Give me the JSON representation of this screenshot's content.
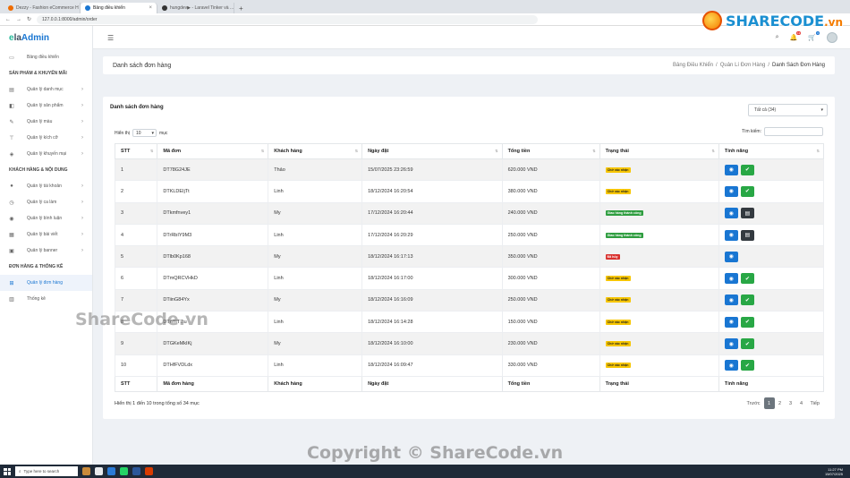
{
  "browser": {
    "tabs": [
      {
        "label": "Dezzy - Fashion eCommerce H",
        "color": "#ef6c00"
      },
      {
        "label": "Bảng điều khiển",
        "color": "#1976d2"
      },
      {
        "label": "hungdev▶ - Laravel Tinker và ...",
        "color": "#333333"
      }
    ],
    "url": "127.0.0.1:8000/admin/order"
  },
  "logo": {
    "e": "e",
    "la": "la",
    "admin": "Admin"
  },
  "sidebar": {
    "dashboard": "Bảng điều khiển",
    "sections": [
      {
        "title": "SẢN PHẨM & KHUYẾN MÃI",
        "items": [
          {
            "label": "Quản lý danh mục",
            "icon": "list-icon"
          },
          {
            "label": "Quản lý sản phẩm",
            "icon": "box-icon"
          },
          {
            "label": "Quản lý màu",
            "icon": "brush-icon"
          },
          {
            "label": "Quản lý kích cỡ",
            "icon": "ruler-icon"
          },
          {
            "label": "Quản lý khuyến mại",
            "icon": "tag-icon"
          }
        ]
      },
      {
        "title": "KHÁCH HÀNG & NỘI DUNG",
        "items": [
          {
            "label": "Quản lý tài khoản",
            "icon": "user-icon"
          },
          {
            "label": "Quản lý ca làm",
            "icon": "clock-icon"
          },
          {
            "label": "Quản lý bình luận",
            "icon": "comment-icon"
          },
          {
            "label": "Quản lý bài viết",
            "icon": "document-icon"
          },
          {
            "label": "Quản lý banner",
            "icon": "image-icon"
          }
        ]
      },
      {
        "title": "ĐƠN HÀNG & THỐNG KÊ",
        "items": [
          {
            "label": "Quản lý đơn hàng",
            "icon": "cart-icon",
            "active": true
          },
          {
            "label": "Thống kê",
            "icon": "chart-icon"
          }
        ]
      }
    ]
  },
  "topbar": {
    "cart_count": "13",
    "notif_count": "0"
  },
  "page": {
    "title": "Danh sách đơn hàng",
    "breadcrumb": [
      "Bảng Điều Khiển",
      "Quản Lí Đơn Hàng",
      "Danh Sách Đơn Hàng"
    ]
  },
  "card": {
    "title": "Danh sách đơn hàng",
    "filter": "Tất cả (34)",
    "show_label": "Hiển thị",
    "show_value": "10",
    "show_unit": "mục",
    "search_label": "Tìm kiếm:",
    "columns": [
      "STT",
      "Mã đơn",
      "Khách hàng",
      "Ngày đặt",
      "Tổng tiền",
      "Trạng thái",
      "Tính năng"
    ],
    "footer_columns": [
      "STT",
      "Mã đơn hàng",
      "Khách hàng",
      "Ngày đặt",
      "Tổng tiền",
      "Trạng thái",
      "Tính năng"
    ],
    "rows": [
      {
        "stt": "1",
        "code": "DT78G24JE",
        "customer": "Thảo",
        "date": "15/07/2025 23:26:59",
        "total": "620.000 VND",
        "status": "Chờ xác nhận",
        "kind": "wait",
        "actions": [
          "view",
          "ok"
        ]
      },
      {
        "stt": "2",
        "code": "DTKLDEIjTt",
        "customer": "Linh",
        "date": "18/12/2024 16:20:54",
        "total": "380.000 VND",
        "status": "Chờ xác nhận",
        "kind": "wait",
        "actions": [
          "view",
          "ok"
        ]
      },
      {
        "stt": "3",
        "code": "DTkmfnvey1",
        "customer": "My",
        "date": "17/12/2024 16:20:44",
        "total": "240.000 VND",
        "status": "Giao hàng thành công",
        "kind": "ok",
        "actions": [
          "view",
          "print"
        ]
      },
      {
        "stt": "4",
        "code": "DTrRbIY9M3",
        "customer": "Linh",
        "date": "17/12/2024 16:20:29",
        "total": "250.000 VND",
        "status": "Giao hàng thành công",
        "kind": "ok",
        "actions": [
          "view",
          "print"
        ]
      },
      {
        "stt": "5",
        "code": "DTlb0Kp168",
        "customer": "My",
        "date": "18/12/2024 16:17:13",
        "total": "350.000 VND",
        "status": "Đã hủy",
        "kind": "cancel",
        "actions": [
          "view"
        ]
      },
      {
        "stt": "6",
        "code": "DTmQRCVHkD",
        "customer": "Linh",
        "date": "18/12/2024 16:17:00",
        "total": "300.000 VND",
        "status": "Chờ xác nhận",
        "kind": "wait",
        "actions": [
          "view",
          "ok"
        ]
      },
      {
        "stt": "7",
        "code": "DTiinG84Yx",
        "customer": "My",
        "date": "18/12/2024 16:16:09",
        "total": "250.000 VND",
        "status": "Chờ xác nhận",
        "kind": "wait",
        "actions": [
          "view",
          "ok"
        ]
      },
      {
        "stt": "8",
        "code": "DTnTIT7tu",
        "customer": "Linh",
        "date": "18/12/2024 16:14:28",
        "total": "150.000 VND",
        "status": "Chờ xác nhận",
        "kind": "wait",
        "actions": [
          "view",
          "ok"
        ]
      },
      {
        "stt": "9",
        "code": "DTGKeMkIKj",
        "customer": "My",
        "date": "18/12/2024 16:10:00",
        "total": "230.000 VND",
        "status": "Chờ xác nhận",
        "kind": "wait",
        "actions": [
          "view",
          "ok"
        ]
      },
      {
        "stt": "10",
        "code": "DTHfFVDLdx",
        "customer": "Linh",
        "date": "18/12/2024 16:09:47",
        "total": "330.000 VND",
        "status": "Chờ xác nhận",
        "kind": "wait",
        "actions": [
          "view",
          "ok"
        ]
      }
    ],
    "info": "Hiển thị 1 đến 10 trong tổng số 34 mục",
    "pager": {
      "prev": "Trước",
      "pages": [
        "1",
        "2",
        "3",
        "4"
      ],
      "next": "Tiếp"
    }
  },
  "watermarks": {
    "left": "ShareCode.vn",
    "bottom": "Copyright © ShareCode.vn"
  },
  "brand": {
    "name": "SHARECODE",
    "tld": ".vn"
  },
  "taskbar": {
    "search": "Type here to search",
    "time": "11:27 PM",
    "date": "15/07/2025"
  }
}
